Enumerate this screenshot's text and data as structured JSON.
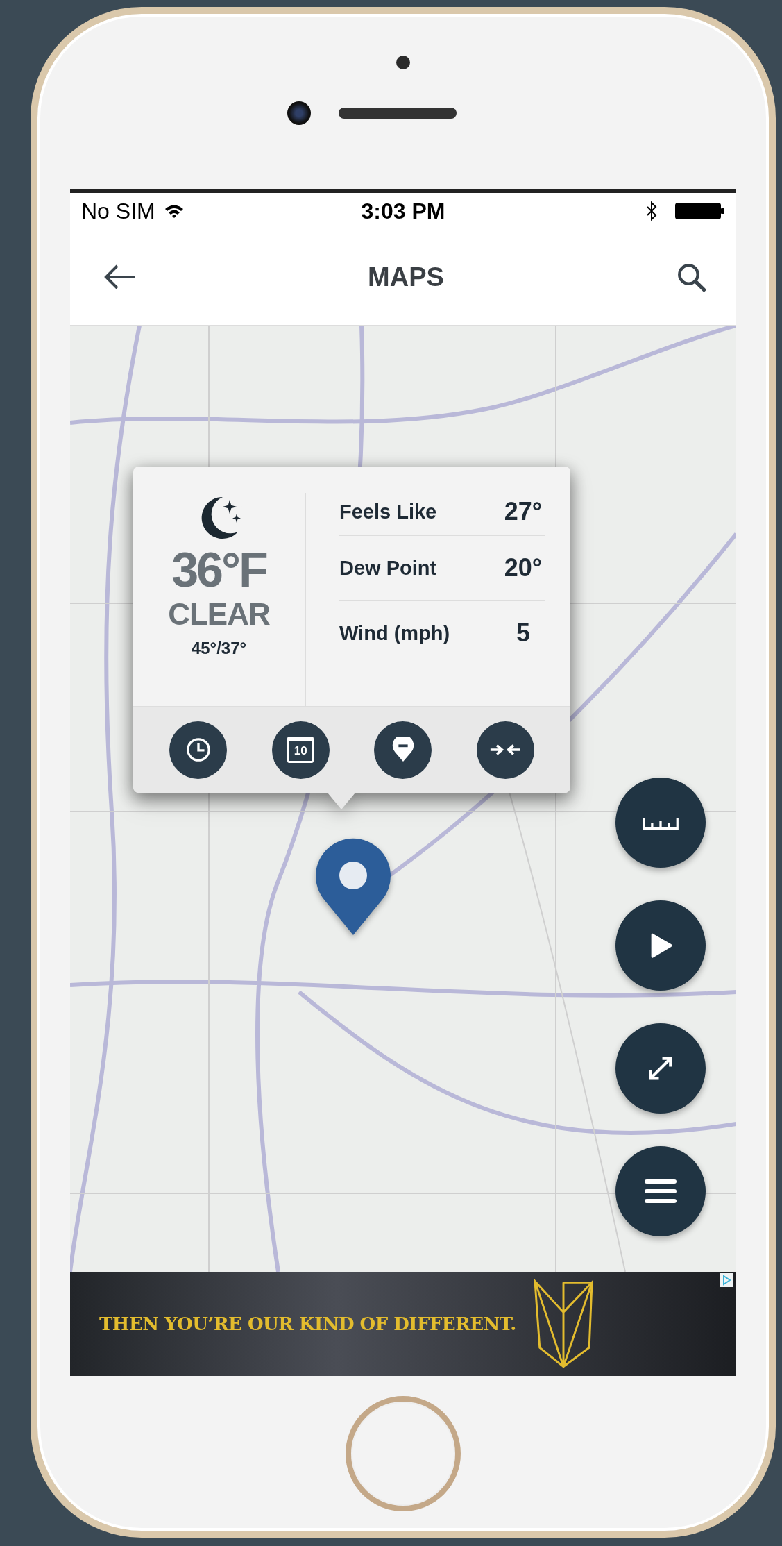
{
  "status_bar": {
    "carrier": "No SIM",
    "time": "3:03 PM"
  },
  "nav": {
    "title": "MAPS"
  },
  "weather": {
    "temperature": "36°F",
    "condition": "CLEAR",
    "high_low": "45°/37°",
    "details": [
      {
        "label": "Feels Like",
        "value": "27°"
      },
      {
        "label": "Dew Point",
        "value": "20°"
      },
      {
        "label": "Wind (mph)",
        "value": "5"
      }
    ],
    "actions": [
      {
        "kind": "clock"
      },
      {
        "kind": "calendar",
        "label": "10"
      },
      {
        "kind": "pin"
      },
      {
        "kind": "collapse"
      }
    ]
  },
  "map_controls": [
    {
      "kind": "ruler"
    },
    {
      "kind": "play"
    },
    {
      "kind": "expand"
    },
    {
      "kind": "menu"
    }
  ],
  "ad": {
    "headline": "THEN YOU’RE OUR KIND OF DIFFERENT."
  }
}
